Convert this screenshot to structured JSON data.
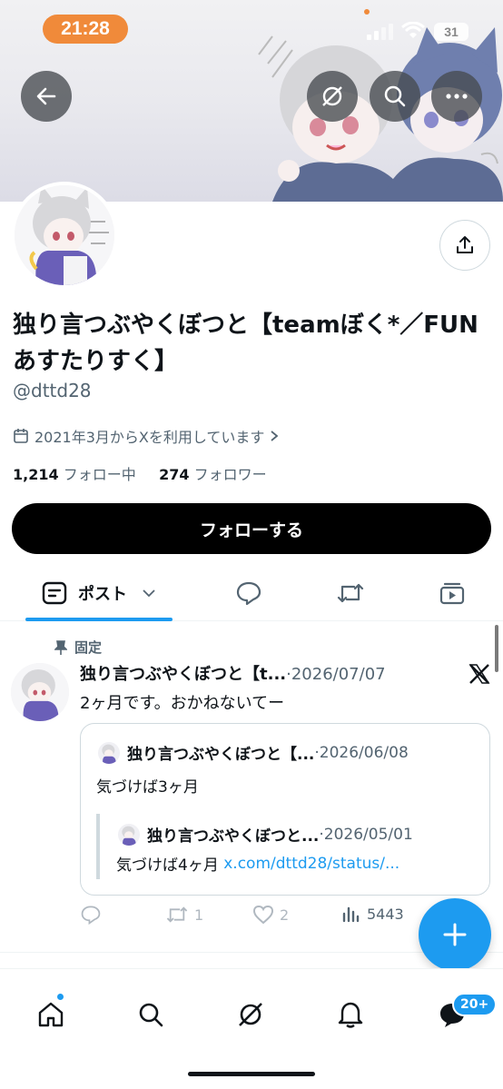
{
  "status_bar": {
    "time": "21:28",
    "battery": "31"
  },
  "header": {
    "icons": [
      "back-arrow-icon",
      "grok-icon",
      "search-icon",
      "more-icon",
      "share-icon"
    ]
  },
  "profile": {
    "name": "独り言つぶやくぼつと【teamぼく*／FUNあすたりすく】",
    "handle": "@dttd28",
    "joined": "2021年3月からXを利用しています",
    "following_count": "1,214",
    "following_label": "フォロー中",
    "followers_count": "274",
    "followers_label": "フォロワー",
    "follow_button": "フォローする"
  },
  "tabs": {
    "posts_label": "ポスト"
  },
  "pinned_post": {
    "pinned_label": "固定",
    "author": "独り言つぶやくぼつと【t...",
    "date": "·2026/07/07",
    "text": "2ヶ月です。おかねないてー",
    "quote": {
      "author": "独り言つぶやくぼつと【...",
      "date": "·2026/06/08",
      "text": "気づけば3ヶ月",
      "nested": {
        "author": "独り言つぶやくぼつと...",
        "date": "·2026/05/01",
        "text": "気づけば4ヶ月",
        "link": "x.com/dttd28/status/..."
      }
    },
    "reposts": "1",
    "likes": "2",
    "views": "5443"
  },
  "bottom_nav": {
    "notifications_badge": "20+"
  },
  "colors": {
    "accent": "#1d9bf0",
    "status_pill": "#f08a3a"
  }
}
